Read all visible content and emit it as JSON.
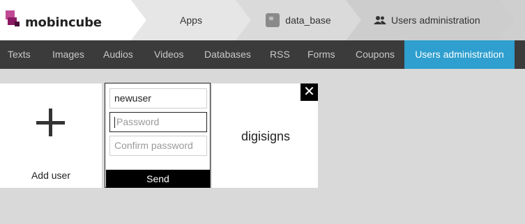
{
  "brand": {
    "name": "mobincube"
  },
  "breadcrumb": {
    "apps": "Apps",
    "database": "data_base",
    "users": "Users administration"
  },
  "nav": {
    "items": [
      "Texts",
      "Images",
      "Audios",
      "Videos",
      "Databases",
      "RSS",
      "Forms",
      "Coupons",
      "Users administration"
    ],
    "active_index": 8
  },
  "add_card": {
    "label": "Add user"
  },
  "user_form": {
    "username_value": "newuser",
    "password_placeholder": "Password",
    "confirm_placeholder": "Confirm password",
    "send_label": "Send"
  },
  "user_card": {
    "name": "digisigns",
    "close_symbol": "✕"
  },
  "colors": {
    "accent": "#2e9fcf",
    "nav_bg": "#3b3b3b",
    "brand_purple": "#a01e78"
  }
}
